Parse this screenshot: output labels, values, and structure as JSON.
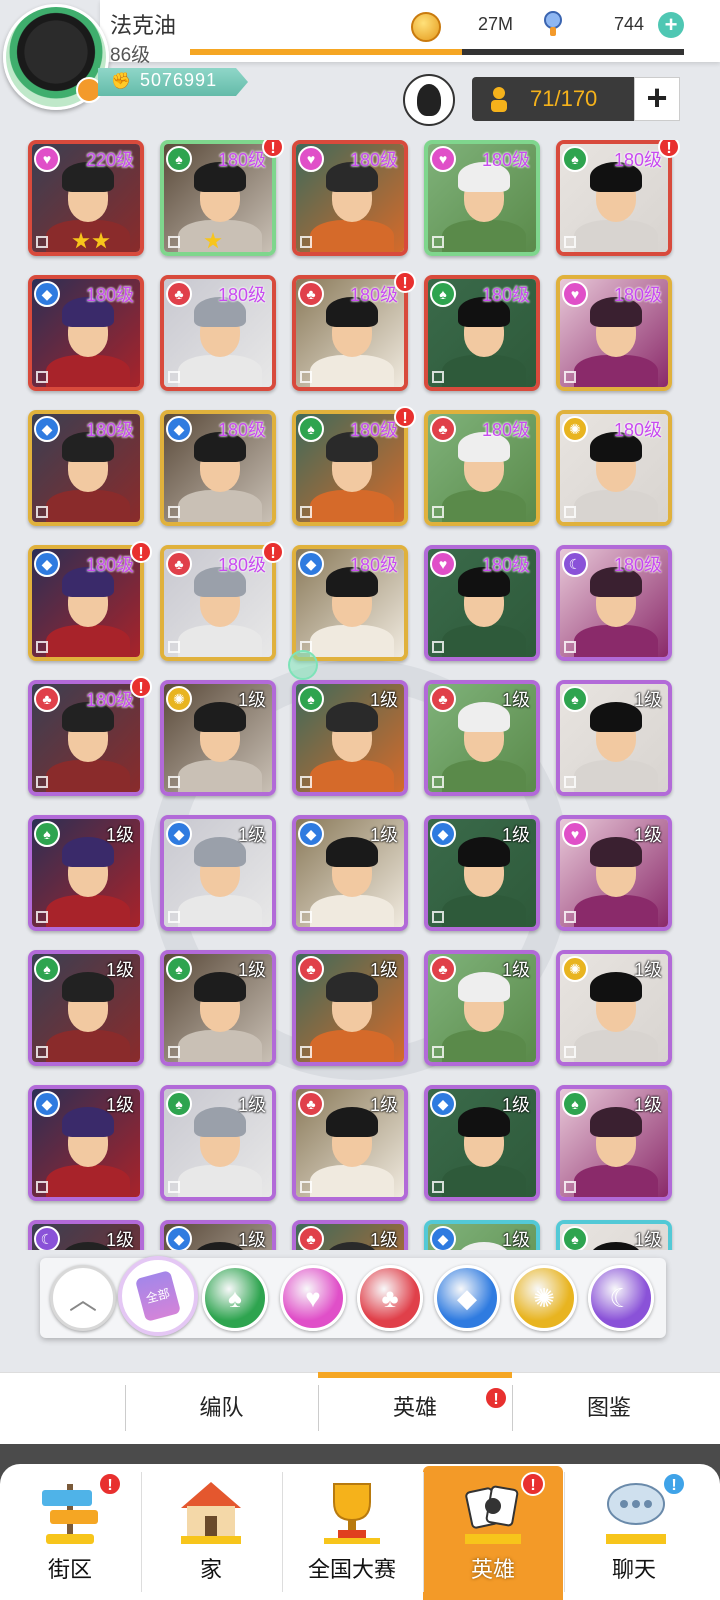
{
  "header": {
    "player_name": "法克油",
    "player_level": "86级",
    "power": "5076991",
    "exp_fraction": 0.55,
    "coins": "27M",
    "gems": "744",
    "hero_capacity": "71/170"
  },
  "heroes": [
    {
      "level": "220级",
      "faction": "heart",
      "rarity": "red",
      "stars": 2,
      "alert": false
    },
    {
      "level": "180级",
      "faction": "spade",
      "rarity": "green",
      "stars": 1,
      "alert": true
    },
    {
      "level": "180级",
      "faction": "heart",
      "rarity": "red",
      "stars": 0,
      "alert": false
    },
    {
      "level": "180级",
      "faction": "heart",
      "rarity": "green",
      "stars": 0,
      "alert": false
    },
    {
      "level": "180级",
      "faction": "spade",
      "rarity": "red",
      "stars": 0,
      "alert": true
    },
    {
      "level": "180级",
      "faction": "diamond",
      "rarity": "red",
      "stars": 0,
      "alert": false
    },
    {
      "level": "180级",
      "faction": "club",
      "rarity": "red",
      "stars": 0,
      "alert": false
    },
    {
      "level": "180级",
      "faction": "club",
      "rarity": "red",
      "stars": 0,
      "alert": true
    },
    {
      "level": "180级",
      "faction": "spade",
      "rarity": "red",
      "stars": 0,
      "alert": false
    },
    {
      "level": "180级",
      "faction": "heart",
      "rarity": "gold",
      "stars": 0,
      "alert": false
    },
    {
      "level": "180级",
      "faction": "diamond",
      "rarity": "gold",
      "stars": 0,
      "alert": false
    },
    {
      "level": "180级",
      "faction": "diamond",
      "rarity": "gold",
      "stars": 0,
      "alert": false
    },
    {
      "level": "180级",
      "faction": "spade",
      "rarity": "gold",
      "stars": 0,
      "alert": true
    },
    {
      "level": "180级",
      "faction": "club",
      "rarity": "gold",
      "stars": 0,
      "alert": false
    },
    {
      "level": "180级",
      "faction": "sun",
      "rarity": "gold",
      "stars": 0,
      "alert": false
    },
    {
      "level": "180级",
      "faction": "diamond",
      "rarity": "gold",
      "stars": 0,
      "alert": true
    },
    {
      "level": "180级",
      "faction": "club",
      "rarity": "gold",
      "stars": 0,
      "alert": true
    },
    {
      "level": "180级",
      "faction": "diamond",
      "rarity": "gold",
      "stars": 0,
      "alert": false
    },
    {
      "level": "180级",
      "faction": "heart",
      "rarity": "purple",
      "stars": 0,
      "alert": false
    },
    {
      "level": "180级",
      "faction": "moon",
      "rarity": "purple",
      "stars": 0,
      "alert": false
    },
    {
      "level": "180级",
      "faction": "club",
      "rarity": "purple",
      "stars": 0,
      "alert": true
    },
    {
      "level": "1级",
      "faction": "sun",
      "rarity": "purple",
      "stars": 0,
      "alert": false
    },
    {
      "level": "1级",
      "faction": "spade",
      "rarity": "purple",
      "stars": 0,
      "alert": false
    },
    {
      "level": "1级",
      "faction": "club",
      "rarity": "purple",
      "stars": 0,
      "alert": false
    },
    {
      "level": "1级",
      "faction": "spade",
      "rarity": "purple",
      "stars": 0,
      "alert": false
    },
    {
      "level": "1级",
      "faction": "spade",
      "rarity": "purple",
      "stars": 0,
      "alert": false
    },
    {
      "level": "1级",
      "faction": "diamond",
      "rarity": "purple",
      "stars": 0,
      "alert": false
    },
    {
      "level": "1级",
      "faction": "diamond",
      "rarity": "purple",
      "stars": 0,
      "alert": false
    },
    {
      "level": "1级",
      "faction": "diamond",
      "rarity": "purple",
      "stars": 0,
      "alert": false
    },
    {
      "level": "1级",
      "faction": "heart",
      "rarity": "purple",
      "stars": 0,
      "alert": false
    },
    {
      "level": "1级",
      "faction": "spade",
      "rarity": "purple",
      "stars": 0,
      "alert": false
    },
    {
      "level": "1级",
      "faction": "spade",
      "rarity": "purple",
      "stars": 0,
      "alert": false
    },
    {
      "level": "1级",
      "faction": "club",
      "rarity": "purple",
      "stars": 0,
      "alert": false
    },
    {
      "level": "1级",
      "faction": "club",
      "rarity": "purple",
      "stars": 0,
      "alert": false
    },
    {
      "level": "1级",
      "faction": "sun",
      "rarity": "purple",
      "stars": 0,
      "alert": false
    },
    {
      "level": "1级",
      "faction": "diamond",
      "rarity": "purple",
      "stars": 0,
      "alert": false
    },
    {
      "level": "1级",
      "faction": "spade",
      "rarity": "purple",
      "stars": 0,
      "alert": false
    },
    {
      "level": "1级",
      "faction": "club",
      "rarity": "purple",
      "stars": 0,
      "alert": false
    },
    {
      "level": "1级",
      "faction": "diamond",
      "rarity": "purple",
      "stars": 0,
      "alert": false
    },
    {
      "level": "1级",
      "faction": "spade",
      "rarity": "purple",
      "stars": 0,
      "alert": false
    },
    {
      "level": "1级",
      "faction": "moon",
      "rarity": "purple",
      "stars": 0,
      "alert": false
    },
    {
      "level": "1级",
      "faction": "diamond",
      "rarity": "purple",
      "stars": 0,
      "alert": false
    },
    {
      "level": "1级",
      "faction": "club",
      "rarity": "purple",
      "stars": 0,
      "alert": false
    },
    {
      "level": "1级",
      "faction": "diamond",
      "rarity": "cyan",
      "stars": 0,
      "alert": false
    },
    {
      "level": "1级",
      "faction": "spade",
      "rarity": "cyan",
      "stars": 0,
      "alert": false
    }
  ],
  "faction_colors": {
    "heart": "#e04fc8",
    "spade": "#2ea44f",
    "club": "#e0404a",
    "diamond": "#2f7be0",
    "sun": "#e8b420",
    "moon": "#8a52d8"
  },
  "filters": {
    "all_label": "全部",
    "items": [
      "spade",
      "heart",
      "club",
      "diamond",
      "sun",
      "moon"
    ]
  },
  "tabs": [
    "编队",
    "英雄",
    "图鉴"
  ],
  "active_tab": 1,
  "nav": {
    "items": [
      {
        "label": "街区",
        "icon": "street-sign-icon",
        "alert": "!",
        "alert_type": "warn"
      },
      {
        "label": "家",
        "icon": "house-icon",
        "alert": "",
        "alert_type": ""
      },
      {
        "label": "全国大赛",
        "icon": "trophy-icon",
        "alert": "",
        "alert_type": ""
      },
      {
        "label": "英雄",
        "icon": "hero-cards-icon",
        "alert": "!",
        "alert_type": "warn"
      },
      {
        "label": "聊天",
        "icon": "chat-bubble-icon",
        "alert": "!",
        "alert_type": "info"
      }
    ],
    "active": 3
  }
}
